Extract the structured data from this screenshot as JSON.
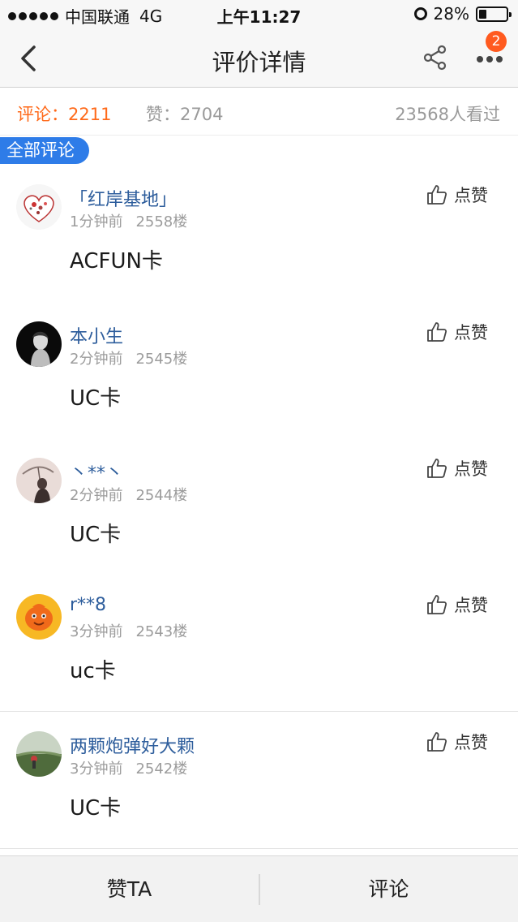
{
  "status_bar": {
    "carrier": "中国联通",
    "network": "4G",
    "time": "上午11:27",
    "battery": "28%",
    "battery_level": 0.28
  },
  "nav": {
    "title": "评价详情",
    "badge_count": "2"
  },
  "stats": {
    "comments": "评论：2211",
    "likes": "赞：2704",
    "views": "23568人看过"
  },
  "tag": "全部评论",
  "comments": [
    {
      "username": "「红岸基地」",
      "time": "1分钟前",
      "floor": "2558楼",
      "content": "ACFUN卡",
      "like_label": "点赞"
    },
    {
      "username": "本小生",
      "time": "2分钟前",
      "floor": "2545楼",
      "content": "UC卡",
      "like_label": "点赞"
    },
    {
      "username": "丶**丶",
      "time": "2分钟前",
      "floor": "2544楼",
      "content": "UC卡",
      "like_label": "点赞"
    },
    {
      "username": "r**8",
      "time": "3分钟前",
      "floor": "2543楼",
      "content": "uc卡",
      "like_label": "点赞"
    },
    {
      "username": "两颗炮弹好大颗",
      "time": "3分钟前",
      "floor": "2542楼",
      "content": "UC卡",
      "like_label": "点赞"
    }
  ],
  "bottom_bar": {
    "like_ta": "赞TA",
    "comment": "评论"
  },
  "colors": {
    "accent_orange": "#ff6a1a",
    "tag_blue": "#2e7ce8",
    "username_blue": "#2d5d9c"
  }
}
